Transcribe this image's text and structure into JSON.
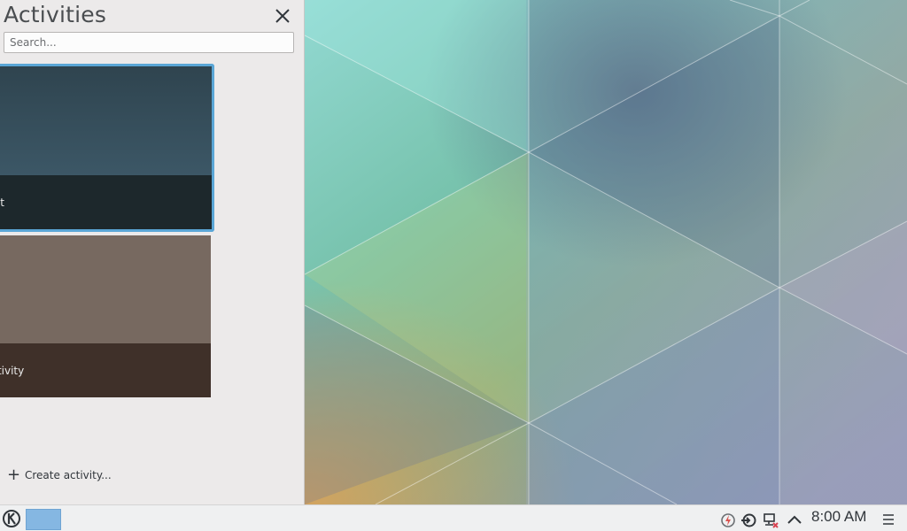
{
  "panel": {
    "title": "Activities",
    "search_placeholder": "Search...",
    "activities": [
      {
        "label": "t",
        "selected": true,
        "colors": {
          "top": "#384f5d",
          "bottom": "#1d282c"
        }
      },
      {
        "label": "activity",
        "selected": false,
        "colors": {
          "top": "#786a60",
          "bottom": "#3f3029"
        }
      }
    ],
    "create_label": "Create activity..."
  },
  "colors": {
    "selection": "#5aa6d6",
    "pager_active": "#85b7e2"
  },
  "taskbar": {
    "clock": "8:00 AM",
    "tray_icons": [
      "power-management-icon",
      "kde-connect-icon",
      "network-disconnected-icon",
      "show-hidden-icons-icon"
    ]
  }
}
